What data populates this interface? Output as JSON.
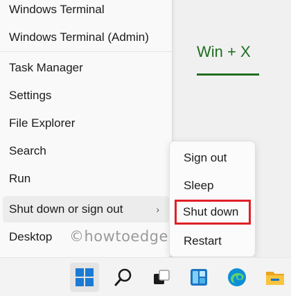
{
  "winx_menu": {
    "items": [
      {
        "label": "Windows Terminal"
      },
      {
        "label": "Windows Terminal (Admin)"
      },
      {
        "label": "Task Manager"
      },
      {
        "label": "Settings"
      },
      {
        "label": "File Explorer"
      },
      {
        "label": "Search"
      },
      {
        "label": "Run"
      },
      {
        "label": "Shut down or sign out",
        "has_submenu": true,
        "submenu_icon": "chevron-right-icon"
      },
      {
        "label": "Desktop"
      }
    ],
    "chevron_glyph": "›"
  },
  "submenu": {
    "items": [
      {
        "label": "Sign out"
      },
      {
        "label": "Sleep"
      },
      {
        "label": "Shut down",
        "highlighted": true
      },
      {
        "label": "Restart"
      }
    ],
    "highlight_color": "#e01f26"
  },
  "annotation": {
    "hotkey_text": "Win + X",
    "color": "#1f6e20"
  },
  "watermark": "©howtoedge",
  "taskbar": {
    "icons": [
      "windows-start-icon",
      "search-icon",
      "task-view-icon",
      "widgets-icon",
      "edge-browser-icon",
      "file-explorer-icon"
    ],
    "accent": "#0067c0"
  }
}
